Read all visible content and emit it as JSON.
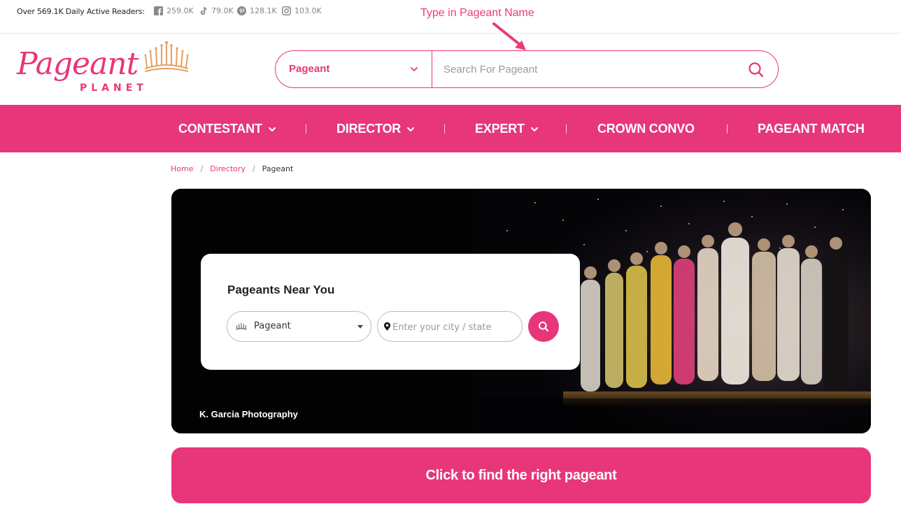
{
  "topbar": {
    "readers": "Over 569.1K Daily Active Readers:",
    "social": [
      {
        "icon": "facebook-icon",
        "count": "259.0K"
      },
      {
        "icon": "tiktok-icon",
        "count": "79.0K"
      },
      {
        "icon": "pinterest-icon",
        "count": "128.1K"
      },
      {
        "icon": "instagram-icon",
        "count": "103.0K"
      }
    ]
  },
  "annotation": {
    "text": "Type in Pageant Name"
  },
  "logo": {
    "word": "Pageant",
    "sub": "PLANET"
  },
  "search": {
    "category": "Pageant",
    "placeholder": "Search For Pageant"
  },
  "nav": {
    "items": [
      {
        "label": "CONTESTANT",
        "has_dropdown": true
      },
      {
        "label": "DIRECTOR",
        "has_dropdown": true
      },
      {
        "label": "EXPERT",
        "has_dropdown": true
      },
      {
        "label": "CROWN CONVO",
        "has_dropdown": false
      },
      {
        "label": "PAGEANT MATCH",
        "has_dropdown": false
      }
    ]
  },
  "breadcrumb": {
    "home": "Home",
    "directory": "Directory",
    "current": "Pageant"
  },
  "hero": {
    "photo_credit": "K. Garcia Photography",
    "card_title": "Pageants Near You",
    "select_value": "Pageant",
    "city_placeholder": "Enter your city / state"
  },
  "cta": {
    "label": "Click to find the right pageant"
  },
  "colors": {
    "brand": "#e8367a",
    "crown": "#e3a15e"
  }
}
